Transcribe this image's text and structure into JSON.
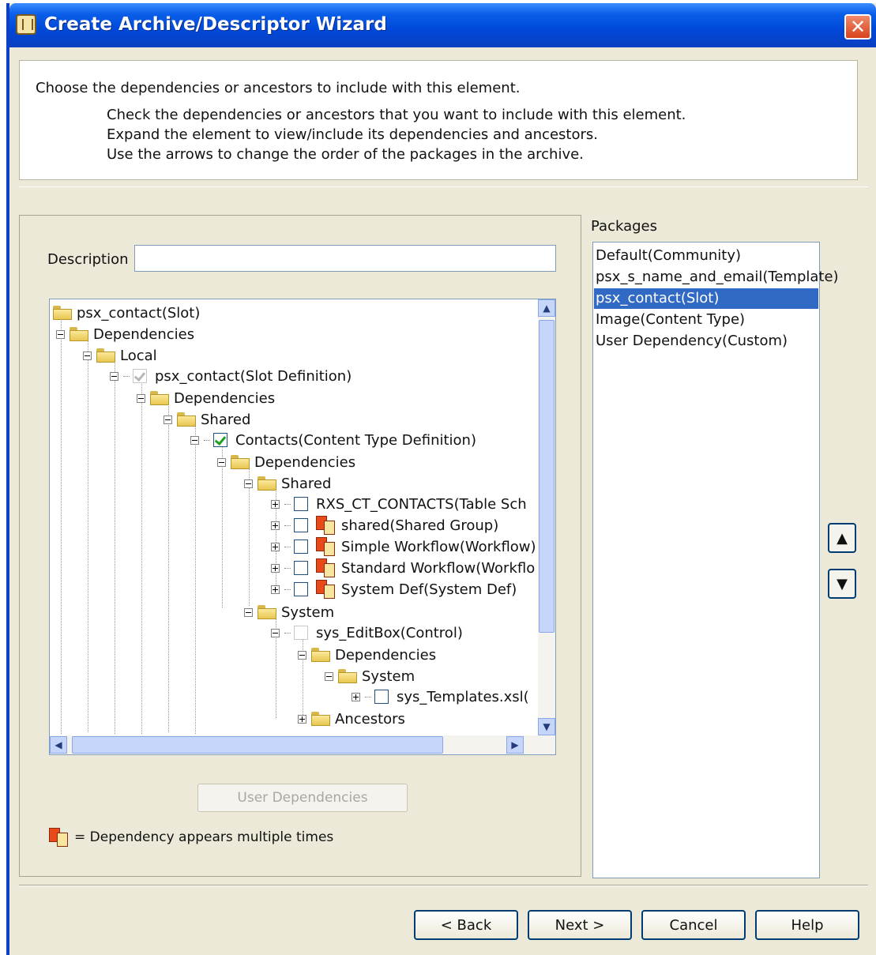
{
  "window": {
    "title": "Create Archive/Descriptor Wizard",
    "close_glyph": "✕"
  },
  "header": {
    "main": "Choose the dependencies or ancestors to include with this element.",
    "lines": [
      "Check the dependencies or ancestors that you want to include with this element.",
      "Expand the element to view/include its dependencies and ancestors.",
      "Use the arrows to change the order of the packages in the archive."
    ]
  },
  "description": {
    "label": "Description",
    "value": ""
  },
  "tree": {
    "nodes": [
      {
        "label": "psx_contact(Slot)",
        "icon": "folder-icon",
        "expander": "none"
      },
      {
        "label": "Dependencies",
        "icon": "folder-icon",
        "expander": "minus"
      },
      {
        "label": "Local",
        "icon": "folder-icon",
        "expander": "minus"
      },
      {
        "label": "psx_contact(Slot Definition)",
        "icon": "checkbox",
        "checked": true,
        "disabled": true,
        "expander": "minus"
      },
      {
        "label": "Dependencies",
        "icon": "folder-icon",
        "expander": "minus"
      },
      {
        "label": "Shared",
        "icon": "folder-icon",
        "expander": "minus"
      },
      {
        "label": "Contacts(Content Type Definition)",
        "icon": "checkbox",
        "checked": true,
        "disabled": false,
        "expander": "minus"
      },
      {
        "label": "Dependencies",
        "icon": "folder-icon",
        "expander": "minus"
      },
      {
        "label": "Shared",
        "icon": "folder-icon",
        "expander": "minus"
      },
      {
        "label": "RXS_CT_CONTACTS(Table Sch",
        "icon": "checkbox",
        "checked": false,
        "expander": "plus"
      },
      {
        "label": "shared(Shared Group)",
        "icon": "checkbox",
        "checked": false,
        "multiple": true,
        "expander": "plus"
      },
      {
        "label": "Simple Workflow(Workflow)",
        "icon": "checkbox",
        "checked": false,
        "multiple": true,
        "expander": "plus"
      },
      {
        "label": "Standard Workflow(Workflo",
        "icon": "checkbox",
        "checked": false,
        "multiple": true,
        "expander": "plus"
      },
      {
        "label": "System Def(System Def)",
        "icon": "checkbox",
        "checked": false,
        "multiple": true,
        "expander": "plus"
      },
      {
        "label": "System",
        "icon": "folder-icon",
        "expander": "minus"
      },
      {
        "label": "sys_EditBox(Control)",
        "icon": "checkbox",
        "checked": false,
        "disabled": true,
        "expander": "minus"
      },
      {
        "label": "Dependencies",
        "icon": "folder-icon",
        "expander": "minus"
      },
      {
        "label": "System",
        "icon": "folder-icon",
        "expander": "minus"
      },
      {
        "label": "sys_Templates.xsl(",
        "icon": "checkbox",
        "checked": false,
        "expander": "plus"
      },
      {
        "label": "Ancestors",
        "icon": "folder-icon",
        "expander": "plus"
      }
    ]
  },
  "buttons": {
    "user_dependencies": "User Dependencies",
    "back": "< Back",
    "next": "Next >",
    "cancel": "Cancel",
    "help": "Help"
  },
  "legend": {
    "text": "= Dependency appears multiple times"
  },
  "packages": {
    "label": "Packages",
    "items": [
      "Default(Community)",
      "psx_s_name_and_email(Template)",
      "psx_contact(Slot)",
      "Image(Content Type)",
      "User Dependency(Custom)"
    ],
    "selected": "psx_contact(Slot)"
  },
  "arrows": {
    "up": "▲",
    "down": "▼"
  },
  "colors": {
    "titlebar": "#0a5ee8",
    "selection": "#316ac5",
    "checkmark": "#21a121"
  }
}
